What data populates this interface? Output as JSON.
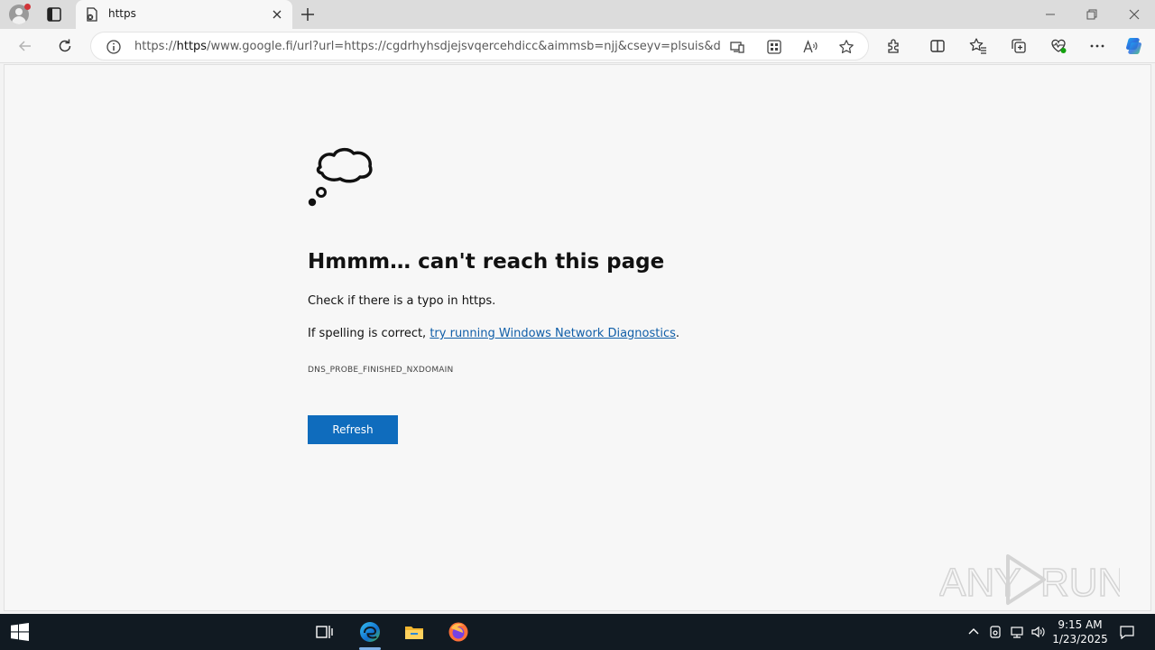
{
  "browser": {
    "tab_title": "https",
    "url_prefix": "https://",
    "url_host": "https",
    "url_rest": "/www.google.fi/url?url=https://cgdrhyhsdjejsvqercehdicc&aimmsb=njj&cseyv=plsuis&dlp=a..."
  },
  "error_page": {
    "heading": "Hmmm… can't reach this page",
    "message1": "Check if there is a typo in https.",
    "message2_prefix": "If spelling is correct, ",
    "message2_link": "try running Windows Network Diagnostics",
    "message2_suffix": ".",
    "error_code": "DNS_PROBE_FINISHED_NXDOMAIN",
    "refresh_label": "Refresh"
  },
  "watermark": {
    "text_left": "ANY",
    "text_right": "RUN"
  },
  "taskbar": {
    "time": "9:15 AM",
    "date": "1/23/2025"
  },
  "colors": {
    "accent": "#0f6cbd",
    "link": "#0f5ea8",
    "taskbar": "#111a22"
  }
}
